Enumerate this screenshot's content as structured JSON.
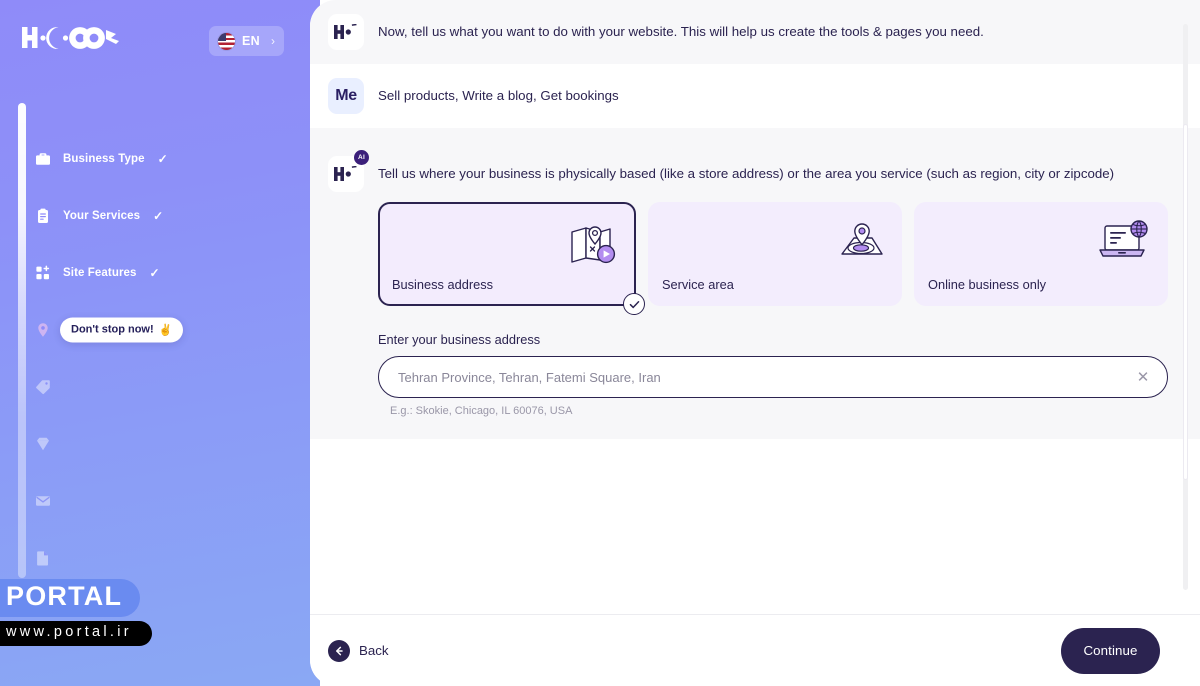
{
  "brand": {
    "logo_text": "HOCOOS"
  },
  "language_selector": {
    "code": "EN",
    "flag": "us-flag-icon",
    "chevron": "›"
  },
  "sidebar": {
    "steps": [
      {
        "label": "Business Type",
        "icon": "briefcase-icon",
        "check": "✓",
        "state": "done"
      },
      {
        "label": "Your Services",
        "icon": "clipboard-icon",
        "check": "✓",
        "state": "done"
      },
      {
        "label": "Site Features",
        "icon": "grid-plus-icon",
        "check": "✓",
        "state": "done"
      },
      {
        "label": "",
        "icon": "location-pin-icon",
        "check": "",
        "state": "current",
        "tooltip": "Don't stop now!",
        "tooltip_emoji": "✌️"
      },
      {
        "label": "",
        "icon": "tag-icon",
        "check": "",
        "state": "upcoming"
      },
      {
        "label": "",
        "icon": "diamond-icon",
        "check": "",
        "state": "upcoming"
      },
      {
        "label": "",
        "icon": "envelope-icon",
        "check": "",
        "state": "upcoming"
      },
      {
        "label": "",
        "icon": "document-icon",
        "check": "",
        "state": "upcoming"
      }
    ]
  },
  "watermark": {
    "title": "PORTAL",
    "url": "www.portal.ir"
  },
  "conversation": [
    {
      "role": "ai",
      "avatar_kind": "hocoos-logo-icon",
      "badge": "",
      "text": "Now, tell us what you want to do with your website. This will help us create the tools & pages you need."
    },
    {
      "role": "me",
      "avatar_kind": "me",
      "avatar_text": "Me",
      "badge": "",
      "text": "Sell products, Write a blog, Get bookings"
    },
    {
      "role": "ai",
      "avatar_kind": "hocoos-logo-icon",
      "badge": "AI",
      "text": "Tell us where your business is physically based (like a store address) or the area you service (such as region, city or zipcode)"
    }
  ],
  "options": [
    {
      "label": "Business address",
      "icon": "map-pin-play-icon",
      "selected": true,
      "check": "✓"
    },
    {
      "label": "Service area",
      "icon": "service-area-icon",
      "selected": false,
      "check": ""
    },
    {
      "label": "Online business only",
      "icon": "laptop-globe-icon",
      "selected": false,
      "check": ""
    }
  ],
  "address_field": {
    "label": "Enter your business address",
    "value": "",
    "placeholder": "Tehran Province, Tehran, Fatemi Square, Iran",
    "clear_icon": "✕",
    "hint": "E.g.: Skokie, Chicago, IL 60076, USA"
  },
  "footer": {
    "back_label": "Back",
    "back_icon": "arrow-left-icon",
    "continue_label": "Continue"
  },
  "colors": {
    "sidebar_top": "#8f8bf9",
    "sidebar_bottom": "#8aa8f4",
    "brand_dark": "#2b2350",
    "card_bg": "#f3edfd",
    "ai_row_bg": "#f7f7f9",
    "accent_purple": "#a87fe6"
  }
}
